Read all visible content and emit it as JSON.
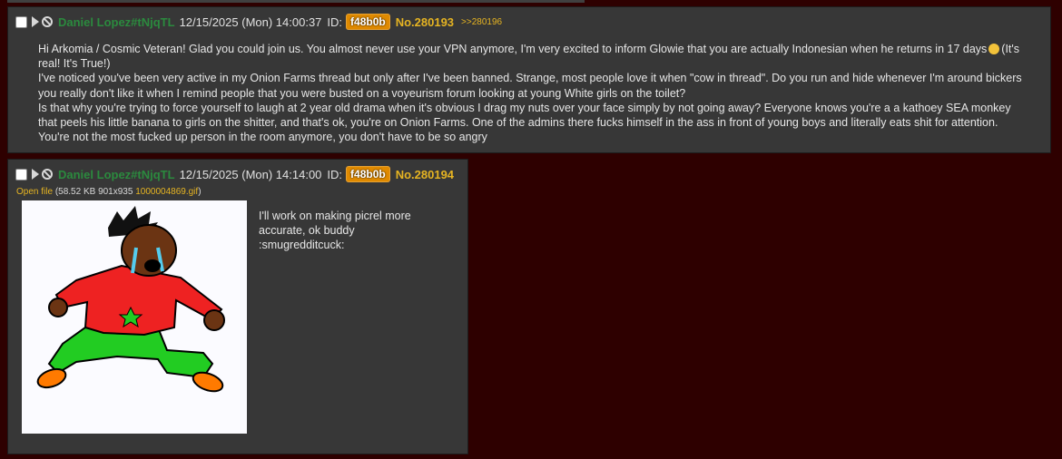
{
  "posts": [
    {
      "author": "Daniel Lopez#tNjqTL",
      "datetime": "12/15/2025 (Mon) 14:00:37",
      "id_label": "ID:",
      "id": "f48b0b",
      "number": "No.280193",
      "backlink": ">>280196",
      "message": [
        "Hi Arkomia / Cosmic Veteran! Glad you could join us. You almost never use your VPN anymore, I'm very excited to inform Glowie that you are actually Indonesian when he returns in 17 days",
        "(It's real! It's True!)",
        "I've noticed you've been very active in my Onion Farms thread but only after I've been banned. Strange, most people love it when \"cow in thread\". Do you run and hide whenever I'm around bickers you really don't like it when I remind people that you were busted on a voyeurism forum looking at young White girls on the toilet?",
        "Is that why you're trying to force yourself to laugh at 2 year old drama when it's obvious I drag my nuts over your face simply by not going away? Everyone knows you're a a kathoey SEA monkey that peels his little banana to girls on the shitter, and that's ok, you're on Onion Farms. One of the admins there fucks himself in the ass in front of young boys and literally eats shit for attention. You're not the most fucked up person in the room anymore, you don't have to be so angry"
      ]
    },
    {
      "author": "Daniel Lopez#tNjqTL",
      "datetime": "12/15/2025 (Mon) 14:14:00",
      "id_label": "ID:",
      "id": "f48b0b",
      "number": "No.280194",
      "file": {
        "open_label": "Open file",
        "meta": "(58.52 KB 901x935",
        "filename": "1000004869.gif",
        "close": ")"
      },
      "message": [
        "I'll work on making picrel more accurate, ok buddy",
        ":smugredditcuck:"
      ]
    }
  ],
  "colors": {
    "background": "#2e0000",
    "post_bg": "#373737",
    "name": "#2b8a3e",
    "id_badge": "#e08a00",
    "post_number": "#e6b422"
  }
}
